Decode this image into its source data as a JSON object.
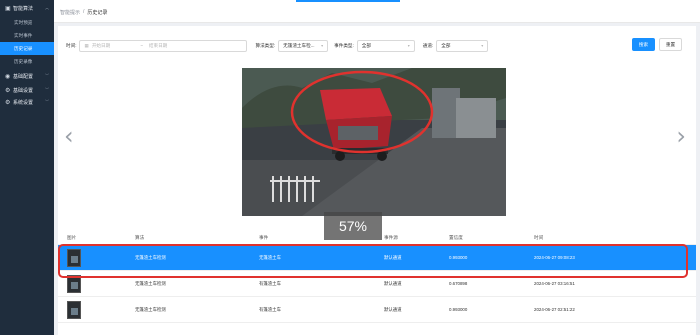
{
  "sidebar": {
    "groups": [
      {
        "label": "智能算法",
        "icon": "monitor-icon"
      },
      {
        "label": "基础配置",
        "icon": "location-icon"
      },
      {
        "label": "基础设置",
        "icon": "gear-icon"
      },
      {
        "label": "系统设置",
        "icon": "settings-icon"
      }
    ],
    "items": [
      "实时预览",
      "实时事件",
      "历史记录",
      "历史录像"
    ],
    "active_index": 2
  },
  "header": {
    "breadcrumb": [
      "智能提示",
      "历史记录"
    ],
    "separator": "/"
  },
  "filters": {
    "time_label": "时间:",
    "start_placeholder": "开始日期",
    "end_placeholder": "结束日期",
    "range_sep": "~",
    "algo_label": "算法类型:",
    "algo_value": "无篷渣土车检...",
    "event_label": "事件类型:",
    "event_value": "全部",
    "channel_label": "通道:",
    "channel_value": "全部",
    "search_button": "搜索",
    "reset_button": "重置"
  },
  "viewer": {
    "progress_text": "57%",
    "prev_icon": "chevron-left-icon",
    "next_icon": "chevron-right-icon"
  },
  "table": {
    "columns": [
      "图片",
      "算法",
      "事件",
      "事件源",
      "置信度",
      "时间"
    ],
    "rows": [
      {
        "algo": "无篷渣土车检测",
        "event": "无篷渣土车",
        "source": "默认通道",
        "confidence": "0.993000",
        "time": "2024-06-27 09:08:23",
        "selected": true
      },
      {
        "algo": "无篷渣土车检测",
        "event": "有篷渣土车",
        "source": "默认通道",
        "confidence": "0.670898",
        "time": "2024-06-27 03:16:51",
        "selected": false
      },
      {
        "algo": "无篷渣土车检测",
        "event": "有篷渣土车",
        "source": "默认通道",
        "confidence": "0.993000",
        "time": "2024-06-27 02:51:22",
        "selected": false
      }
    ]
  },
  "colors": {
    "accent": "#1890ff",
    "sidebar_bg": "#1f2d3d",
    "highlight_outline": "#e0322e"
  }
}
